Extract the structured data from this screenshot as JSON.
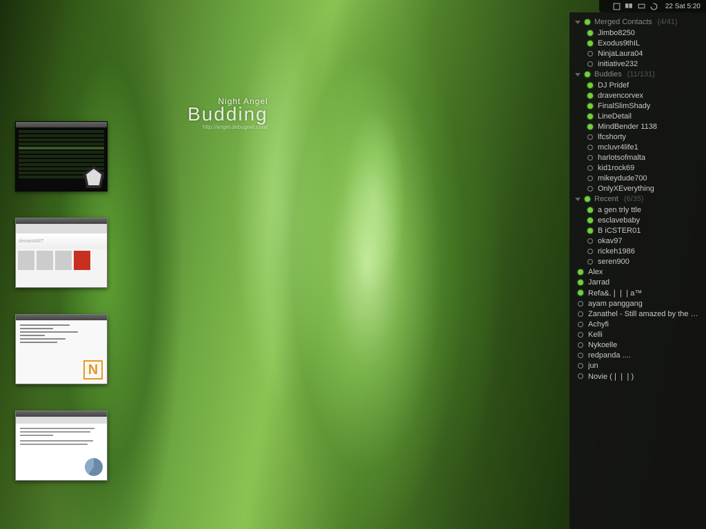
{
  "wallpaper": {
    "artist": "Night Angel",
    "title": "Budding",
    "url": "http://angel.debugnet.com/"
  },
  "topbar": {
    "clock": "22 Sat 5:20",
    "icons": [
      "app-icon-1",
      "app-icon-2",
      "volume-icon",
      "sync-icon"
    ]
  },
  "buddylist": {
    "groups": [
      {
        "name": "Merged Contacts",
        "count": "(4/41)",
        "items": [
          {
            "name": "Jimbo8250",
            "status": "online"
          },
          {
            "name": "Exodus9thIL",
            "status": "online"
          },
          {
            "name": "NinjaLaura04",
            "status": "away"
          },
          {
            "name": "initiative232",
            "status": "away"
          }
        ]
      },
      {
        "name": "Buddies",
        "count": "(11/131)",
        "items": [
          {
            "name": "DJ Pridef",
            "status": "online"
          },
          {
            "name": "dravencorvex",
            "status": "online"
          },
          {
            "name": "FinalSlimShady",
            "status": "online"
          },
          {
            "name": "LineDetail",
            "status": "online"
          },
          {
            "name": "MindBender 1138",
            "status": "online"
          },
          {
            "name": "lfcshorty",
            "status": "away"
          },
          {
            "name": "mcluvr4life1",
            "status": "away"
          },
          {
            "name": "harlotsofmalta",
            "status": "away"
          },
          {
            "name": "kid1rock69",
            "status": "away"
          },
          {
            "name": "mikeydude700",
            "status": "away"
          },
          {
            "name": "OnlyXEverything",
            "status": "away"
          }
        ]
      },
      {
        "name": "Recent",
        "count": "(6/35)",
        "items": [
          {
            "name": "a gen trly ttle",
            "status": "online"
          },
          {
            "name": "esclavebaby",
            "status": "online"
          },
          {
            "name": "B     iCSTER01",
            "status": "online"
          },
          {
            "name": "okav97",
            "status": "away"
          },
          {
            "name": "rickeh1986",
            "status": "away"
          },
          {
            "name": "seren900",
            "status": "away"
          }
        ]
      }
    ],
    "toplevel": [
      {
        "name": "Alex",
        "status": "online"
      },
      {
        "name": "Jarrad",
        "status": "online"
      },
      {
        "name": "Refa&.❘❘❘a™",
        "status": "online"
      },
      {
        "name": "ayam panggang",
        "status": "away"
      },
      {
        "name": "Zanathel - Still amazed by the ma...",
        "status": "away"
      },
      {
        "name": "Achyfi",
        "status": "away"
      },
      {
        "name": "Kelli",
        "status": "away"
      },
      {
        "name": "Nykoelle",
        "status": "away"
      },
      {
        "name": "redpanda ....",
        "status": "away"
      },
      {
        "name": "jun",
        "status": "away"
      },
      {
        "name": "Novie (❘❘❘)",
        "status": "away"
      }
    ]
  },
  "thumbnails": {
    "web_logo": "deviantART",
    "code_logo": "N"
  }
}
